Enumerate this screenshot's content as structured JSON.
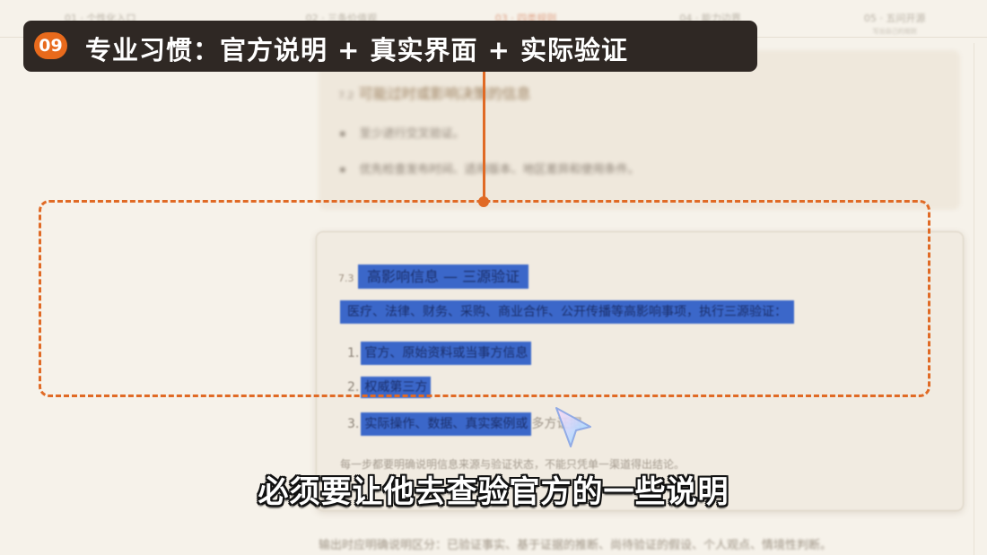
{
  "tabs": [
    {
      "label": "01 · 个性化入口",
      "sub": "",
      "active": false
    },
    {
      "label": "02 · 三条价值观",
      "sub": "",
      "active": false
    },
    {
      "label": "03 · 四类规则",
      "sub": "",
      "active": true
    },
    {
      "label": "04 · 能力边界",
      "sub": "",
      "active": false
    },
    {
      "label": "05 · 五问开源",
      "sub": "写出自己的规则",
      "active": false
    }
  ],
  "banner": {
    "badge": "09",
    "title": "专业习惯：官方说明 + 真实界面 + 实际验证"
  },
  "doc": {
    "section_72": {
      "number": "7.2",
      "title": "可能过时或影响决策的信息",
      "bullets": [
        "至少进行交叉验证。",
        "优先检查发布时间、适用版本、地区差异和使用条件。"
      ]
    },
    "section_73": {
      "number": "7.3",
      "title": "高影响信息 — 三源验证",
      "intro": "医疗、法律、财务、采购、商业合作、公开传播等高影响事项，执行三源验证：",
      "steps": [
        {
          "num": "1.",
          "text": "官方、原始资料或当事方信息"
        },
        {
          "num": "2.",
          "text": "权威第三方"
        },
        {
          "num": "3.",
          "text": "实际操作、数据、真实案例或",
          "after": "多方证据"
        }
      ],
      "note": "每一步都要明确说明信息来源与验证状态，不能只凭单一渠道得出结论。"
    },
    "footer": "输出时应明确说明区分：已验证事实、基于证据的推断、尚待验证的假设、个人观点、情境性判断。"
  },
  "subtitle": "必须要让他去查验官方的一些说明",
  "colors": {
    "accent_orange": "#e06a25",
    "banner_bg": "#2f2824",
    "highlight_blue": "#3b67c9",
    "page_bg": "#f6f2ea"
  }
}
